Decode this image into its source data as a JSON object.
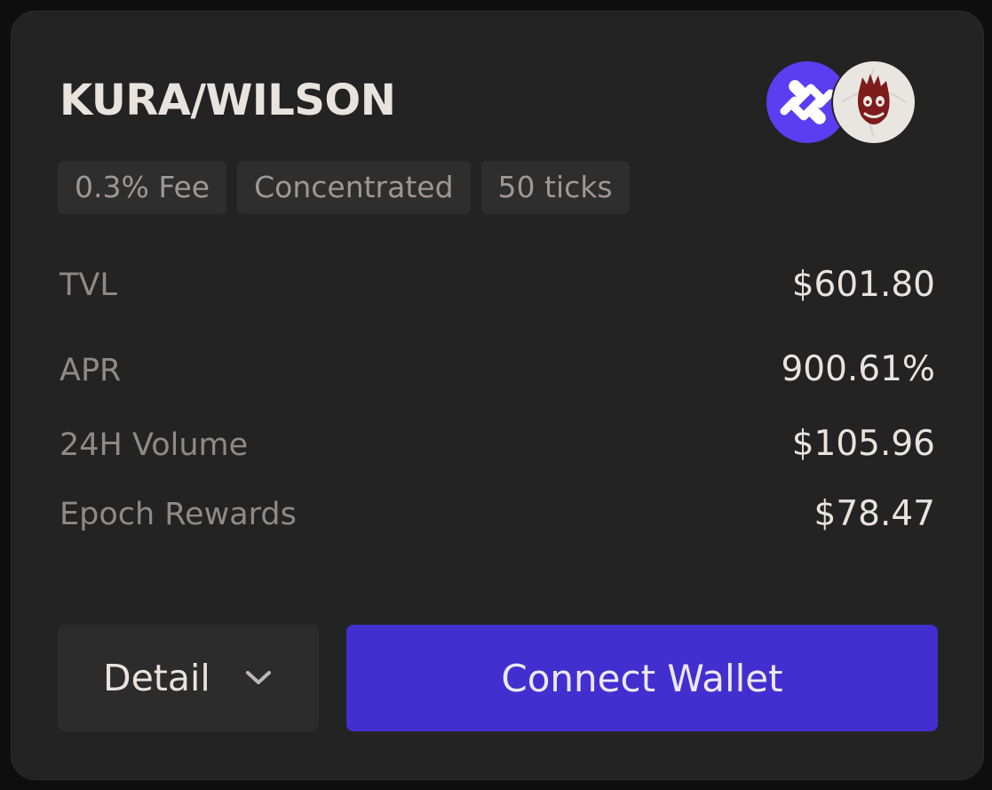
{
  "pool": {
    "title": "KURA/WILSON",
    "token_icons": [
      "kura-token-icon",
      "wilson-token-icon"
    ],
    "tags": [
      "0.3% Fee",
      "Concentrated",
      "50 ticks"
    ],
    "stats": [
      {
        "label": "TVL",
        "value": "$601.80"
      },
      {
        "label": "APR",
        "value": "900.61%"
      },
      {
        "label": "24H Volume",
        "value": "$105.96"
      },
      {
        "label": "Epoch Rewards",
        "value": "$78.47"
      }
    ]
  },
  "actions": {
    "detail_label": "Detail",
    "detail_icon": "chevron-down-icon",
    "connect_label": "Connect Wallet"
  },
  "colors": {
    "background": "#0e0e0e",
    "card": "#232323",
    "text_primary": "#e9e3de",
    "text_secondary": "#8e8a87",
    "tag_bg": "#2e2e2e",
    "accent": "#432fd0",
    "kura_brand": "#5b3df2"
  }
}
